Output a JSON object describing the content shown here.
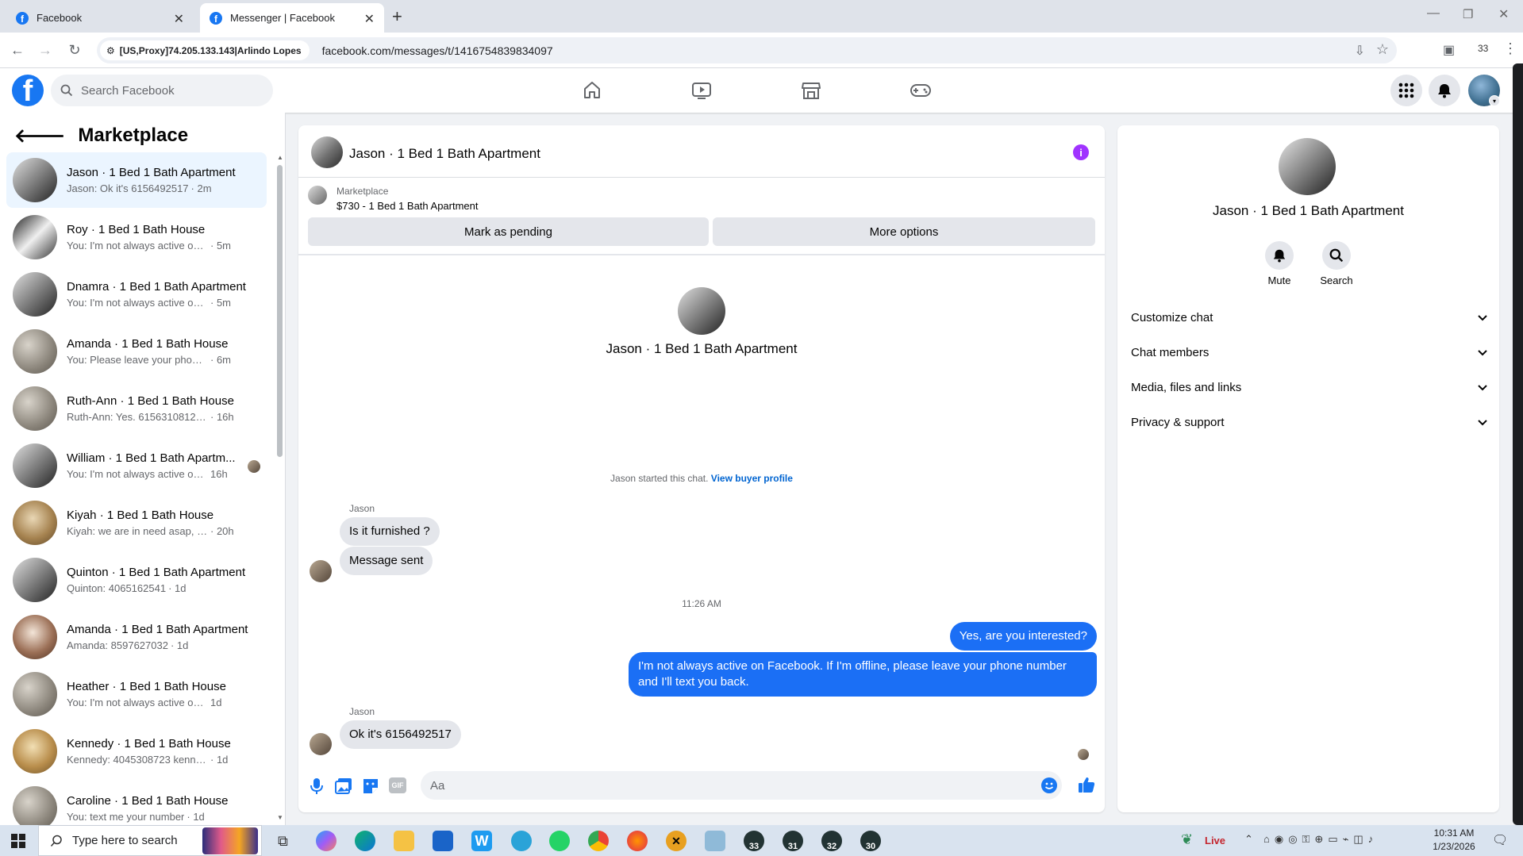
{
  "browser": {
    "tabs": [
      {
        "title": "Facebook"
      },
      {
        "title": "Messenger | Facebook"
      }
    ],
    "site_label": "[US,Proxy]74.205.133.143|Arlindo Lopes",
    "url": "facebook.com/messages/t/1416754839834097",
    "ext_count": "33"
  },
  "fb": {
    "search_placeholder": "Search Facebook"
  },
  "left": {
    "title": "Marketplace",
    "conversations": [
      {
        "name": "Jason · 1 Bed 1 Bath Apartment",
        "preview": "Jason: Ok it's 6156492517",
        "time": "· 2m",
        "active": true
      },
      {
        "name": "Roy · 1 Bed 1 Bath House",
        "preview": "You: I'm not always active on Face...",
        "time": "· 5m"
      },
      {
        "name": "Dnamra · 1 Bed 1 Bath Apartment",
        "preview": "You: I'm not always active on Face...",
        "time": "· 5m"
      },
      {
        "name": "Amanda · 1 Bed 1 Bath House",
        "preview": "You: Please leave your phone num...",
        "time": "· 6m"
      },
      {
        "name": "Ruth-Ann · 1 Bed 1 Bath House",
        "preview": "Ruth-Ann: Yes. 6156310812. What...",
        "time": "· 16h"
      },
      {
        "name": "William · 1 Bed 1 Bath Apartm...",
        "preview": "You: I'm not always active on Fa...",
        "time": "16h"
      },
      {
        "name": "Kiyah · 1 Bed 1 Bath House",
        "preview": "Kiyah: we are in need asap, my bo...",
        "time": "· 20h"
      },
      {
        "name": "Quinton · 1 Bed 1 Bath Apartment",
        "preview": "Quinton: 4065162541",
        "time": "· 1d"
      },
      {
        "name": "Amanda · 1 Bed 1 Bath Apartment",
        "preview": "Amanda: 8597627032",
        "time": "· 1d"
      },
      {
        "name": "Heather · 1 Bed 1 Bath House",
        "preview": "You: I'm not always active on Faceb...",
        "time": "1d"
      },
      {
        "name": "Kennedy · 1 Bed 1 Bath House",
        "preview": "Kennedy: 4045308723 kennedy",
        "time": "· 1d"
      },
      {
        "name": "Caroline · 1 Bed 1 Bath House",
        "preview": "You: text me your number",
        "time": "· 1d"
      }
    ]
  },
  "chat": {
    "title": "Jason · 1 Bed 1 Bath Apartment",
    "listing_source": "Marketplace",
    "listing": "$730 - 1 Bed 1 Bath Apartment",
    "mark_pending": "Mark as pending",
    "more_options": "More options",
    "profile_name": "Jason · 1 Bed 1 Bath Apartment",
    "started_text": "Jason started this chat.",
    "view_buyer": "View buyer profile",
    "sender1": "Jason",
    "msg1": "Is it furnished ?",
    "msg2": "Message sent",
    "timestamp": "11:26 AM",
    "msg3": "Yes, are you interested?",
    "msg4": "I'm not always active on Facebook. If I'm offline, please leave your phone number and I'll text you back.",
    "sender2": "Jason",
    "msg5": "Ok it's 6156492517",
    "composer_placeholder": "Aa"
  },
  "right": {
    "name": "Jason · 1 Bed 1 Bath Apartment",
    "mute": "Mute",
    "search": "Search",
    "sections": [
      "Customize chat",
      "Chat members",
      "Media, files and links",
      "Privacy & support"
    ]
  },
  "taskbar": {
    "search_placeholder": "Type here to search",
    "live": "Live",
    "time": "10:31 AM",
    "date": "1/23/2026",
    "badges": [
      "33",
      "31",
      "32",
      "30"
    ]
  },
  "colors": {
    "fb_blue": "#1877f2",
    "bubble_me": "#1b6ff5",
    "bubble_them": "#e4e6eb",
    "info_purple": "#a033ff"
  }
}
